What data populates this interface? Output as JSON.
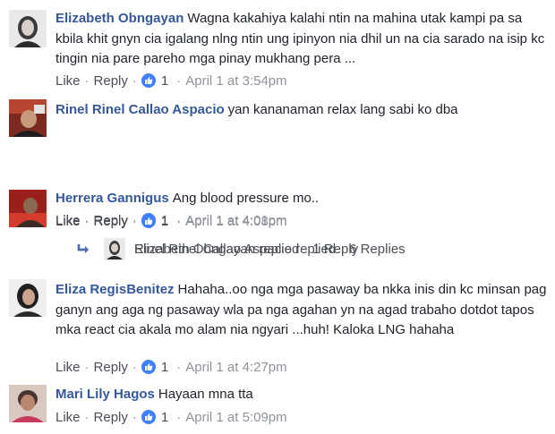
{
  "comments": [
    {
      "author": "Elizabeth Obngayan",
      "text": "Wagna kakahiya kalahi ntin na mahina utak kampi pa sa kbila khit gnyn cia igalang nlng ntin ung ipinyon nia dhil un na cia sarado na isip kc tingin nia pare pareho mga pinay mukhang pera ...",
      "like_label": "Like",
      "reply_label": "Reply",
      "like_count": "1",
      "date": "April 1 at 3:54pm"
    },
    {
      "author": "Rinel Rinel Callao Aspacio",
      "text": "yan kananaman relax lang sabi ko dba",
      "like_label": "Like",
      "reply_label": "Reply",
      "like_count": "1",
      "date": "April 1 at 4:01pm",
      "replies": {
        "name": "Rinel Rinel Callao Aspacio replied",
        "count": "6 Replies"
      }
    },
    {
      "author": "Herrera Gannigus",
      "text": "Ang blood pressure mo..",
      "like_label": "Like",
      "reply_label": "Reply",
      "like_count": "1",
      "date": "April 1 at 4:08pm",
      "replies": {
        "name": "Elizabeth Obngayan replied",
        "count": "1 Reply"
      }
    },
    {
      "author": "Eliza RegisBenitez",
      "text": "Hahaha..oo nga mga pasaway ba nkka inis din kc minsan pag ganyn ang aga ng pasaway wla pa nga agahan yn na agad trabaho dotdot tapos mka react cia akala mo alam nia ngyari ...huh! Kaloka LNG hahaha",
      "like_label": "Like",
      "reply_label": "Reply",
      "like_count": "1",
      "date": "April 1 at 4:27pm"
    },
    {
      "author": "Mari Lily Hagos",
      "text": "Hayaan mna tta",
      "like_label": "Like",
      "reply_label": "Reply",
      "like_count": "1",
      "date": "April 1 at 5:09pm"
    }
  ],
  "separator": "·",
  "colors": {
    "author": "#365899",
    "text": "#1d2129",
    "meta": "#90949c",
    "like_badge": "#4080ff"
  }
}
